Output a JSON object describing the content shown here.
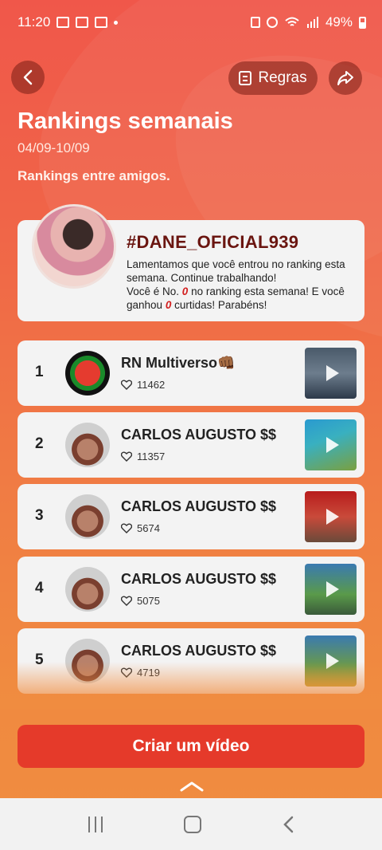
{
  "status_bar": {
    "time": "11:20",
    "battery": "49%"
  },
  "header": {
    "rules_label": "Regras",
    "title": "Rankings semanais",
    "dates": "04/09-10/09",
    "subtitle": "Rankings entre amigos."
  },
  "me": {
    "name": "#DANE_OFICIAL939",
    "msg_line1": "Lamentamos que você entrou no ranking esta semana. Continue trabalhando!",
    "msg_line2_a": "Você é No. ",
    "rank": "0",
    "msg_line2_b": " no ranking esta semana! E você ganhou ",
    "likes": "0",
    "msg_line2_c": " curtidas! Parabéns!"
  },
  "ranking": [
    {
      "rank": "1",
      "name": "RN Multiverso👊🏾",
      "likes": "11462"
    },
    {
      "rank": "2",
      "name": "CARLOS AUGUSTO $$",
      "likes": "11357"
    },
    {
      "rank": "3",
      "name": "CARLOS AUGUSTO $$",
      "likes": "5674"
    },
    {
      "rank": "4",
      "name": "CARLOS AUGUSTO $$",
      "likes": "5075"
    },
    {
      "rank": "5",
      "name": "CARLOS AUGUSTO $$",
      "likes": "4719"
    }
  ],
  "cta": {
    "create_label": "Criar um vídeo"
  },
  "colors": {
    "accent": "#e53a2a",
    "name_dark": "#6a1510",
    "highlight": "#d21f1f"
  }
}
